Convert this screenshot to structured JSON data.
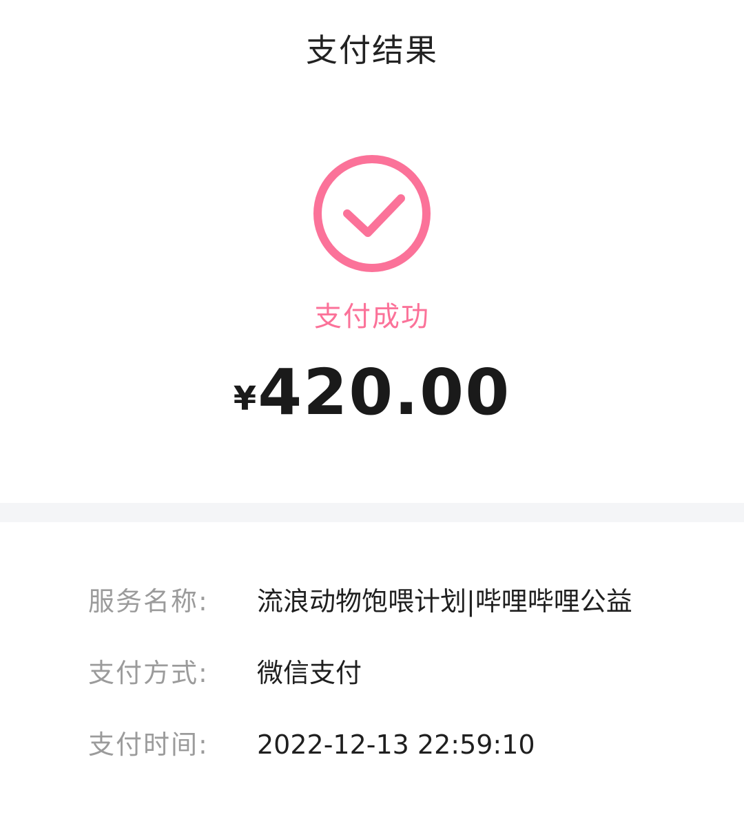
{
  "header": {
    "title": "支付结果"
  },
  "status": {
    "icon": "check-circle-icon",
    "text": "支付成功",
    "color": "#fb7299"
  },
  "amount": {
    "currency": "¥",
    "value": "420.00"
  },
  "details": [
    {
      "label": "服务名称:",
      "value": "流浪动物饱喂计划|哔哩哔哩公益"
    },
    {
      "label": "支付方式:",
      "value": "微信支付"
    },
    {
      "label": "支付时间:",
      "value": "2022-12-13 22:59:10"
    }
  ]
}
